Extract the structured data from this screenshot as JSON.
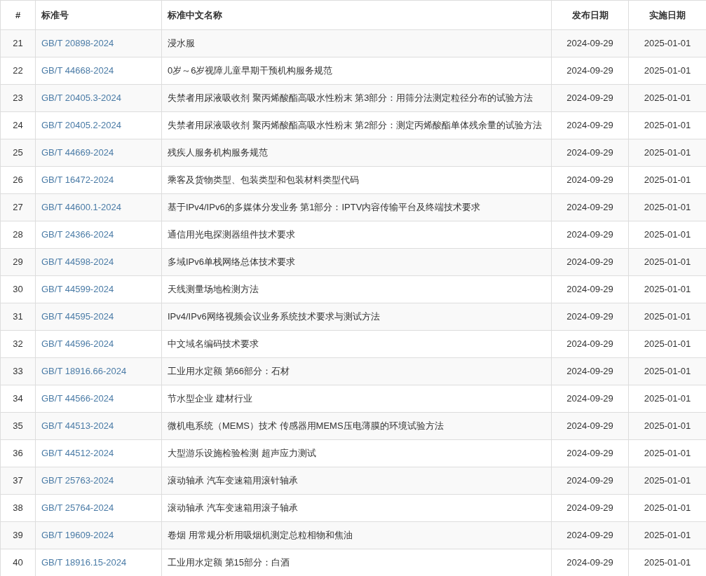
{
  "table": {
    "columns": [
      "#",
      "标准号",
      "标准中文名称",
      "发布日期",
      "实施日期"
    ],
    "rows": [
      {
        "index": "21",
        "code": "GB/T 20898-2024",
        "name": "浸水服",
        "published": "2024-09-29",
        "effective": "2025-01-01"
      },
      {
        "index": "22",
        "code": "GB/T 44668-2024",
        "name": "0岁～6岁视障儿童早期干预机构服务规范",
        "published": "2024-09-29",
        "effective": "2025-01-01"
      },
      {
        "index": "23",
        "code": "GB/T 20405.3-2024",
        "name": "失禁者用尿液吸收剂 聚丙烯酸酯高吸水性粉末 第3部分：用筛分法测定粒径分布的试验方法",
        "published": "2024-09-29",
        "effective": "2025-01-01"
      },
      {
        "index": "24",
        "code": "GB/T 20405.2-2024",
        "name": "失禁者用尿液吸收剂 聚丙烯酸酯高吸水性粉末 第2部分：测定丙烯酸酯单体残余量的试验方法",
        "published": "2024-09-29",
        "effective": "2025-01-01"
      },
      {
        "index": "25",
        "code": "GB/T 44669-2024",
        "name": "残疾人服务机构服务规范",
        "published": "2024-09-29",
        "effective": "2025-01-01"
      },
      {
        "index": "26",
        "code": "GB/T 16472-2024",
        "name": "乘客及货物类型、包装类型和包装材料类型代码",
        "published": "2024-09-29",
        "effective": "2025-01-01"
      },
      {
        "index": "27",
        "code": "GB/T 44600.1-2024",
        "name": "基于IPv4/IPv6的多媒体分发业务 第1部分：IPTV内容传输平台及终端技术要求",
        "published": "2024-09-29",
        "effective": "2025-01-01"
      },
      {
        "index": "28",
        "code": "GB/T 24366-2024",
        "name": "通信用光电探测器组件技术要求",
        "published": "2024-09-29",
        "effective": "2025-01-01"
      },
      {
        "index": "29",
        "code": "GB/T 44598-2024",
        "name": "多域IPv6单栈网络总体技术要求",
        "published": "2024-09-29",
        "effective": "2025-01-01"
      },
      {
        "index": "30",
        "code": "GB/T 44599-2024",
        "name": "天线测量场地检测方法",
        "published": "2024-09-29",
        "effective": "2025-01-01"
      },
      {
        "index": "31",
        "code": "GB/T 44595-2024",
        "name": "IPv4/IPv6网络视频会议业务系统技术要求与测试方法",
        "published": "2024-09-29",
        "effective": "2025-01-01"
      },
      {
        "index": "32",
        "code": "GB/T 44596-2024",
        "name": "中文域名编码技术要求",
        "published": "2024-09-29",
        "effective": "2025-01-01"
      },
      {
        "index": "33",
        "code": "GB/T 18916.66-2024",
        "name": "工业用水定额 第66部分：石材",
        "published": "2024-09-29",
        "effective": "2025-01-01"
      },
      {
        "index": "34",
        "code": "GB/T 44566-2024",
        "name": "节水型企业 建材行业",
        "published": "2024-09-29",
        "effective": "2025-01-01"
      },
      {
        "index": "35",
        "code": "GB/T 44513-2024",
        "name": "微机电系统（MEMS）技术 传感器用MEMS压电薄膜的环境试验方法",
        "published": "2024-09-29",
        "effective": "2025-01-01"
      },
      {
        "index": "36",
        "code": "GB/T 44512-2024",
        "name": "大型游乐设施检验检测 超声应力测试",
        "published": "2024-09-29",
        "effective": "2025-01-01"
      },
      {
        "index": "37",
        "code": "GB/T 25763-2024",
        "name": "滚动轴承 汽车变速箱用滚针轴承",
        "published": "2024-09-29",
        "effective": "2025-01-01"
      },
      {
        "index": "38",
        "code": "GB/T 25764-2024",
        "name": "滚动轴承 汽车变速箱用滚子轴承",
        "published": "2024-09-29",
        "effective": "2025-01-01"
      },
      {
        "index": "39",
        "code": "GB/T 19609-2024",
        "name": "卷烟 用常规分析用吸烟机测定总粒相物和焦油",
        "published": "2024-09-29",
        "effective": "2025-01-01"
      },
      {
        "index": "40",
        "code": "GB/T 18916.15-2024",
        "name": "工业用水定额 第15部分：白酒",
        "published": "2024-09-29",
        "effective": "2025-01-01"
      }
    ]
  }
}
